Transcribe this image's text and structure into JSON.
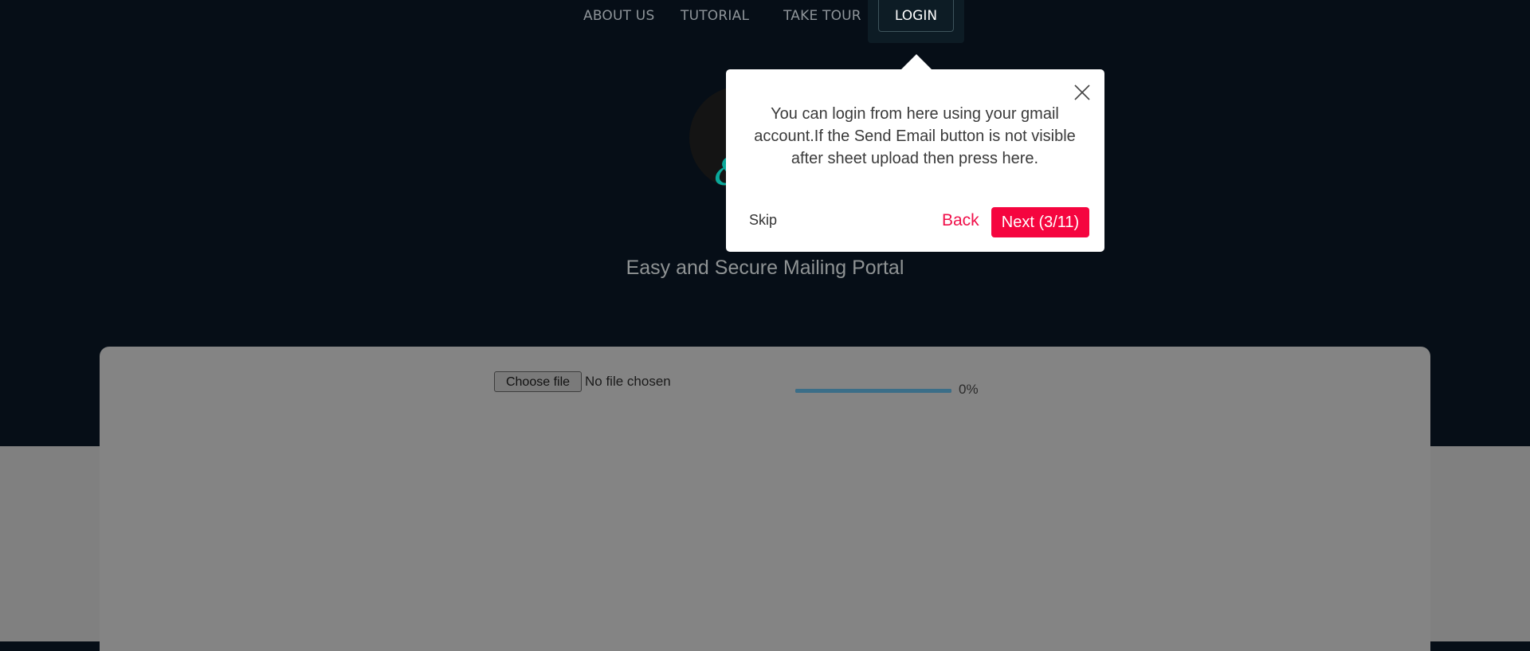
{
  "nav": {
    "about_label": "ABOUT US",
    "tutorial_label": "TUTORIAL",
    "tour_label": "TAKE TOUR",
    "login_label": "LOGIN"
  },
  "hero": {
    "tagline": "Easy and Secure Mailing Portal",
    "logo_glyph": "&"
  },
  "upload": {
    "choose_file_label": "Choose file",
    "file_status": "No file chosen",
    "progress_percent_label": "0%",
    "progress_value": 0
  },
  "tour_popover": {
    "message": "You can login from here using your gmail account.If the Send Email button is not visible after sheet upload then press here.",
    "skip_label": "Skip",
    "back_label": "Back",
    "next_label": "Next (3/11)",
    "close_icon": "close-icon"
  },
  "colors": {
    "page_bg_dark": "#060e17",
    "accent_red": "#f5053f",
    "card_bg": "#848484",
    "progress_bar": "#3b6e88",
    "logo_accent": "#0aa89a"
  }
}
